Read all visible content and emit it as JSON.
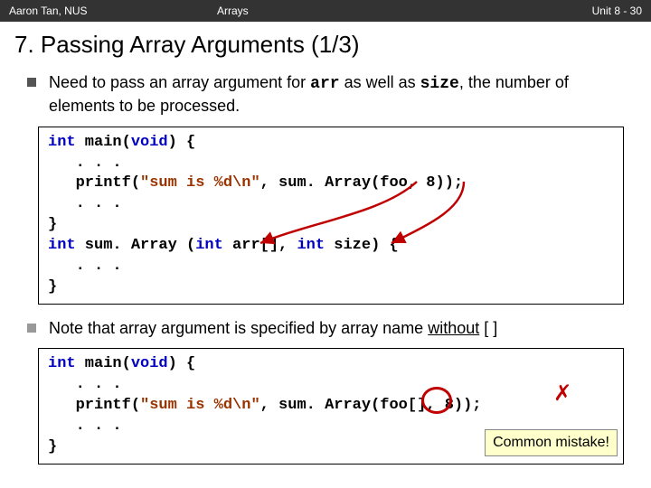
{
  "header": {
    "left": "Aaron Tan, NUS",
    "center": "Arrays",
    "right": "Unit 8 - 30"
  },
  "title": "7. Passing Array Arguments (1/3)",
  "bullet1": {
    "pre": "Need to pass an array argument for ",
    "code1": "arr",
    "mid": " as well as ",
    "code2": "size",
    "post": ", the number of elements to be processed."
  },
  "code1": {
    "l1a": "int",
    "l1b": " main(",
    "l1c": "void",
    "l1d": ") {",
    "l2": "   . . .",
    "l3a": "   printf(",
    "l3b": "\"sum is %d\\n\"",
    "l3c": ", sum. Array(foo, 8));",
    "l4": "   . . .",
    "l5": "}",
    "l6a": "int",
    "l6b": " sum. Array (",
    "l6c": "int",
    "l6d": " arr[], ",
    "l6e": "int",
    "l6f": " size) {",
    "l7": "   . . .",
    "l8": "}"
  },
  "bullet2": {
    "pre": "Note that array argument is specified by array name ",
    "under": "without",
    "post": " [ ]"
  },
  "code2": {
    "l1a": "int",
    "l1b": " main(",
    "l1c": "void",
    "l1d": ") {",
    "l2": "   . . .",
    "l3a": "   printf(",
    "l3b": "\"sum is %d\\n\"",
    "l3c": ", sum. Array(foo[], 8));",
    "l4": "   . . .",
    "l5": "}"
  },
  "callout": "Common mistake!"
}
